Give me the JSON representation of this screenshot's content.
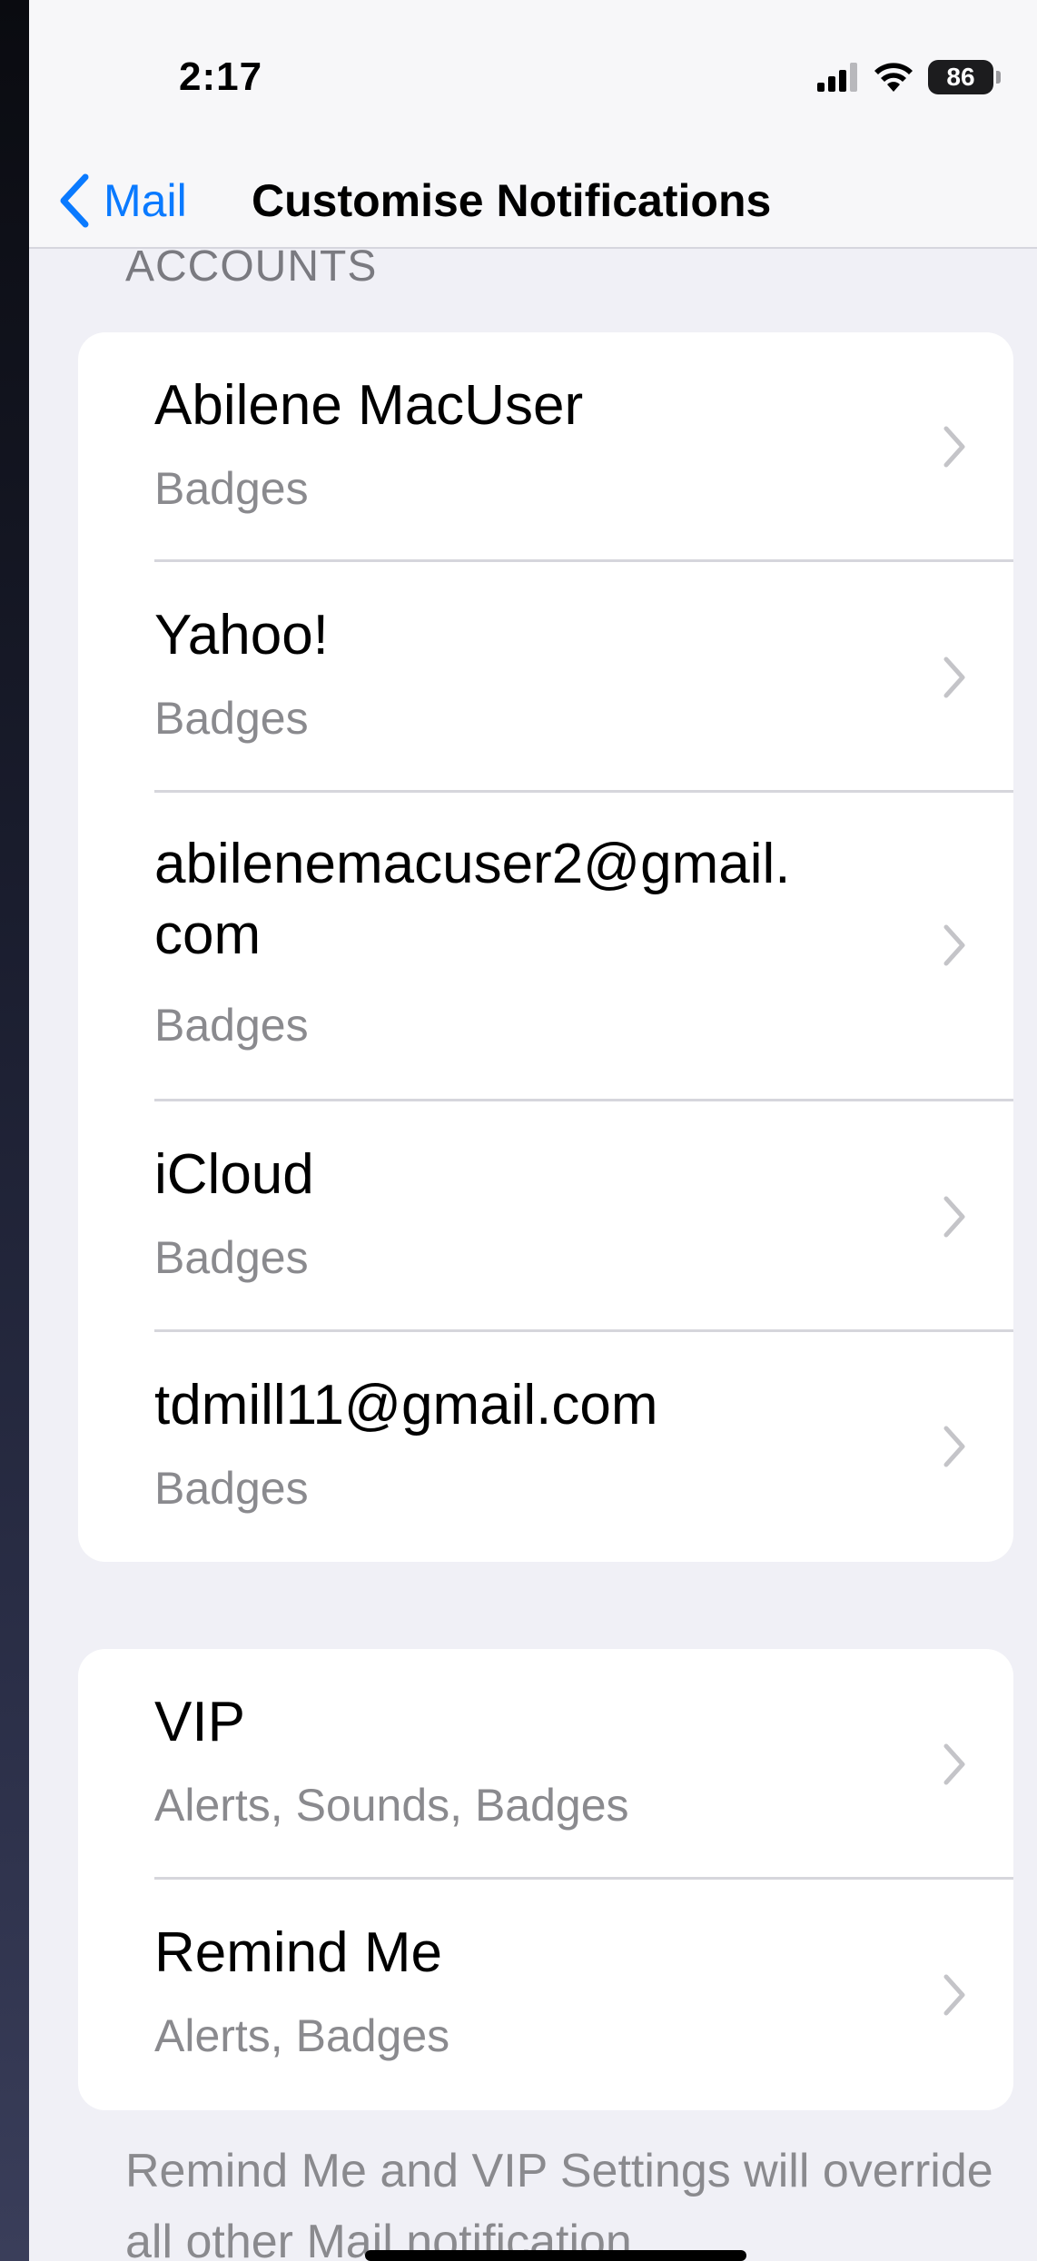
{
  "status_bar": {
    "time": "2:17",
    "battery_level": "86",
    "icons": [
      "signal-icon",
      "wifi-icon",
      "battery-icon"
    ]
  },
  "nav": {
    "back_label": "Mail",
    "title": "Customise Notifications"
  },
  "accounts_section": {
    "header": "ACCOUNTS",
    "items": [
      {
        "title": "Abilene MacUser",
        "subtitle": "Badges"
      },
      {
        "title": "Yahoo!",
        "subtitle": "Badges"
      },
      {
        "title": "abilenemacuser2@gmail.\ncom",
        "subtitle": "Badges"
      },
      {
        "title": "iCloud",
        "subtitle": "Badges"
      },
      {
        "title": "tdmill11@gmail.com",
        "subtitle": "Badges"
      }
    ]
  },
  "special_section": {
    "items": [
      {
        "title": "VIP",
        "subtitle": "Alerts, Sounds, Badges"
      },
      {
        "title": "Remind Me",
        "subtitle": "Alerts, Badges"
      }
    ]
  },
  "footer_note": "Remind Me and VIP Settings will override all other Mail notification",
  "colors": {
    "accent": "#0a7aff",
    "background": "#f0f0f6",
    "secondary_text": "#8a8a8e"
  }
}
